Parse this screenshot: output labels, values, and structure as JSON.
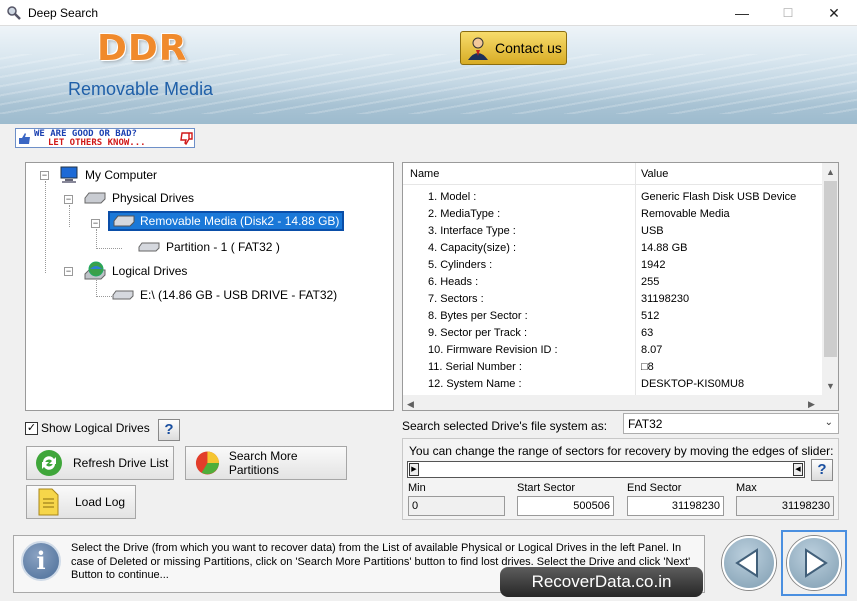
{
  "window": {
    "title": "Deep Search",
    "min": "—",
    "max": "☐",
    "close": "✕"
  },
  "banner": {
    "logo": "DDR",
    "subtitle": "Removable Media",
    "contact_label": "Contact us"
  },
  "feedback": {
    "line1": "WE ARE GOOD OR BAD?",
    "line2": "LET OTHERS KNOW..."
  },
  "tree": {
    "root": "My Computer",
    "physical": "Physical Drives",
    "removable": "Removable Media (Disk2 - 14.88 GB)",
    "partition": "Partition - 1 ( FAT32 )",
    "logical": "Logical Drives",
    "drive_e": "E:\\ (14.86 GB - USB DRIVE - FAT32)"
  },
  "props": {
    "col_name": "Name",
    "col_value": "Value",
    "rows": [
      {
        "n": "1. Model :",
        "v": "Generic Flash Disk USB Device"
      },
      {
        "n": "2. MediaType :",
        "v": "Removable Media"
      },
      {
        "n": "3. Interface Type :",
        "v": "USB"
      },
      {
        "n": "4. Capacity(size) :",
        "v": "14.88 GB"
      },
      {
        "n": "5. Cylinders :",
        "v": "1942"
      },
      {
        "n": "6. Heads :",
        "v": "255"
      },
      {
        "n": "7. Sectors :",
        "v": "31198230"
      },
      {
        "n": "8. Bytes per Sector :",
        "v": "512"
      },
      {
        "n": "9. Sector per Track :",
        "v": "63"
      },
      {
        "n": "10. Firmware Revision ID :",
        "v": "8.07"
      },
      {
        "n": "11. Serial Number :",
        "v": "□8"
      },
      {
        "n": "12. System Name :",
        "v": "DESKTOP-KIS0MU8"
      }
    ]
  },
  "controls": {
    "show_logical": "Show Logical Drives",
    "show_logical_checked": true,
    "refresh": "Refresh Drive List",
    "search_more": "Search More Partitions",
    "load_log": "Load Log",
    "help": "?"
  },
  "filesystem": {
    "label": "Search selected Drive's file system as:",
    "value": "FAT32"
  },
  "range": {
    "hint": "You can change the range of sectors for recovery by moving the edges of slider:",
    "min_label": "Min",
    "min": "0",
    "start_label": "Start Sector",
    "start": "500506",
    "end_label": "End Sector",
    "end": "31198230",
    "max_label": "Max",
    "max": "31198230"
  },
  "status": {
    "text": "Select the Drive (from which you want to recover data) from the List of available Physical or Logical Drives in the left Panel. In case of Deleted or missing Partitions, click on 'Search More Partitions' button to find lost drives. Select the Drive and click 'Next' Button to continue...",
    "info_glyph": "i",
    "badge": "RecoverData.co.in"
  },
  "icons": [
    "app-icon",
    "contact-avatar-icon",
    "thumbs-icon",
    "computer-icon",
    "drive-icon",
    "usb-drive-icon",
    "partition-icon",
    "logical-drives-icon",
    "refresh-icon",
    "pie-chart-icon",
    "log-icon",
    "info-icon",
    "back-arrow-icon",
    "next-arrow-icon"
  ],
  "colors": {
    "logo": "#f08a2c",
    "subtitle": "#1f5fa8",
    "selection": "#1a78d8",
    "contact": "#e6c240"
  }
}
